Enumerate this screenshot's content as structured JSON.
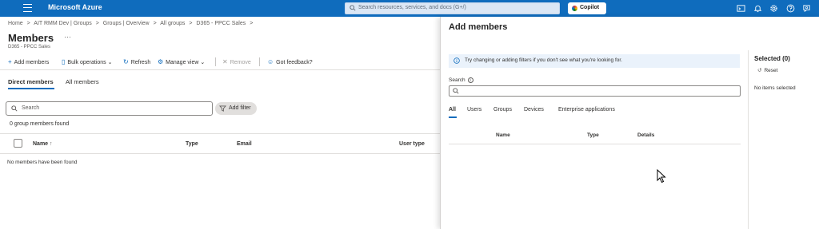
{
  "topbar": {
    "brand": "Microsoft Azure",
    "search_placeholder": "Search resources, services, and docs (G+/)",
    "copilot_label": "Copilot",
    "icons": [
      "terminal-icon",
      "bell-icon",
      "gear-icon",
      "help-icon",
      "feedback-icon"
    ]
  },
  "breadcrumb": [
    "Home",
    ">",
    "AIT RMM Dev | Groups",
    ">",
    "Groups | Overview",
    ">",
    "All groups",
    ">",
    "D365 - PPCC Sales",
    ">"
  ],
  "page": {
    "title": "Members",
    "ellipsis": "···",
    "subtitle": "D365 - PPCC Sales"
  },
  "toolbar": {
    "add_members": "Add members",
    "bulk_operations": "Bulk operations",
    "refresh": "Refresh",
    "manage_view": "Manage view",
    "remove": "Remove",
    "feedback": "Got feedback?"
  },
  "tabs": {
    "direct": "Direct members",
    "all": "All members"
  },
  "filter": {
    "search_placeholder": "Search",
    "add_filter": "Add filter"
  },
  "list": {
    "count_text": "0 group members found",
    "columns": {
      "name": "Name",
      "sort_glyph": "↑",
      "type": "Type",
      "email": "Email",
      "user_type": "User type"
    },
    "empty_text": "No members have been found"
  },
  "panel": {
    "title": "Add members",
    "info_text": "Try changing or adding filters if you don't see what you're looking for.",
    "search_label": "Search",
    "search_info_glyph": "i",
    "search_value": "",
    "tabs": [
      "All",
      "Users",
      "Groups",
      "Devices",
      "Enterprise applications"
    ],
    "columns": {
      "name": "Name",
      "type": "Type",
      "details": "Details"
    },
    "selected_title": "Selected (0)",
    "reset": "Reset",
    "no_items": "No items selected"
  },
  "colors": {
    "topbar": "#0f6cbd",
    "accent": "#0f6cbd",
    "info_bg": "#eaf2fb"
  }
}
